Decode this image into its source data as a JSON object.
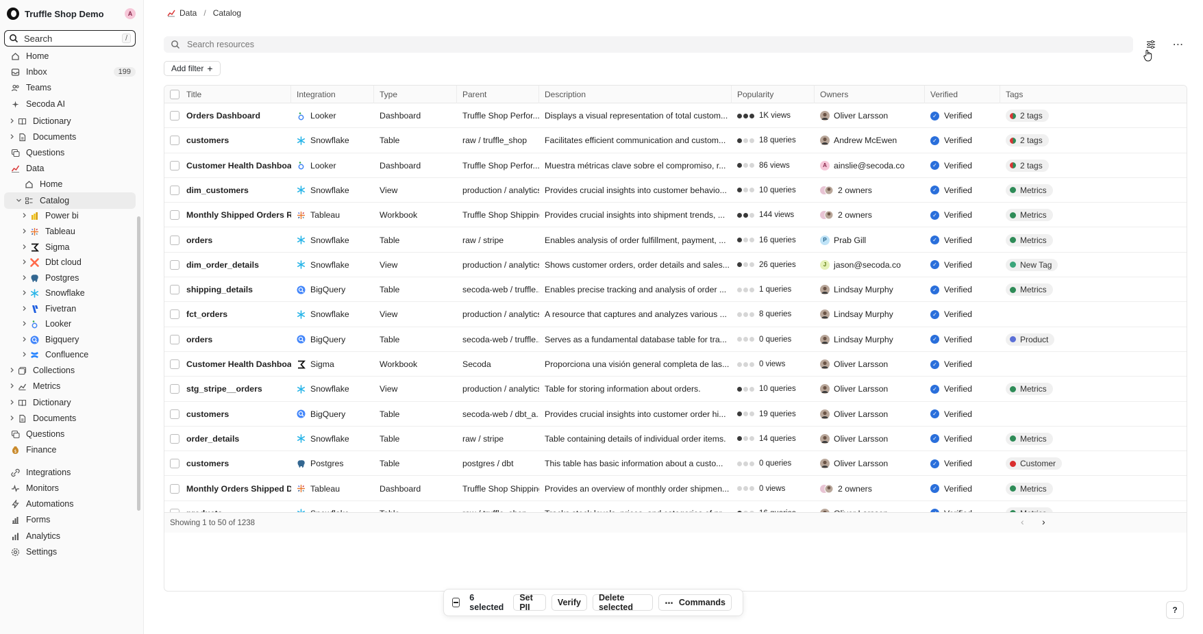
{
  "workspace": {
    "name": "Truffle Shop Demo",
    "avatar": "A"
  },
  "sidebar": {
    "search_label": "Search",
    "search_shortcut": "/",
    "items": [
      {
        "label": "Home",
        "icon": "home-icon",
        "depth": 0
      },
      {
        "label": "Inbox",
        "icon": "inbox-icon",
        "depth": 0,
        "count": "199"
      },
      {
        "label": "Teams",
        "icon": "teams-icon",
        "depth": 0
      },
      {
        "label": "Secoda AI",
        "icon": "sparkle-icon",
        "depth": 0
      },
      {
        "label": "Dictionary",
        "icon": "book-icon",
        "depth": 0,
        "chevron": true
      },
      {
        "label": "Documents",
        "icon": "document-icon",
        "depth": 0,
        "chevron": true
      },
      {
        "label": "Questions",
        "icon": "question-icon",
        "depth": 0
      },
      {
        "label": "Data",
        "icon": "chart-icon",
        "depth": 0,
        "section": true
      },
      {
        "label": "Home",
        "icon": "home-icon",
        "depth": 1
      },
      {
        "label": "Catalog",
        "icon": "catalog-icon",
        "depth": 1,
        "chevron": true,
        "expanded": true,
        "active": true
      },
      {
        "label": "Power bi",
        "icon": "powerbi-icon",
        "depth": 2,
        "chevron": true
      },
      {
        "label": "Tableau",
        "icon": "tableau-icon",
        "depth": 2,
        "chevron": true
      },
      {
        "label": "Sigma",
        "icon": "sigma-icon",
        "depth": 2,
        "chevron": true
      },
      {
        "label": "Dbt cloud",
        "icon": "dbt-icon",
        "depth": 2,
        "chevron": true
      },
      {
        "label": "Postgres",
        "icon": "postgres-icon",
        "depth": 2,
        "chevron": true
      },
      {
        "label": "Snowflake",
        "icon": "snowflake-icon",
        "depth": 2,
        "chevron": true
      },
      {
        "label": "Fivetran",
        "icon": "fivetran-icon",
        "depth": 2,
        "chevron": true
      },
      {
        "label": "Looker",
        "icon": "looker-icon",
        "depth": 2,
        "chevron": true
      },
      {
        "label": "Bigquery",
        "icon": "bigquery-icon",
        "depth": 2,
        "chevron": true
      },
      {
        "label": "Confluence",
        "icon": "confluence-icon",
        "depth": 2,
        "chevron": true
      },
      {
        "label": "Collections",
        "icon": "collections-icon",
        "depth": 0,
        "chevron": true
      },
      {
        "label": "Metrics",
        "icon": "metrics-icon",
        "depth": 0,
        "chevron": true
      },
      {
        "label": "Dictionary",
        "icon": "book-icon",
        "depth": 0,
        "chevron": true
      },
      {
        "label": "Documents",
        "icon": "document-icon",
        "depth": 0,
        "chevron": true
      },
      {
        "label": "Questions",
        "icon": "question-icon",
        "depth": 0
      },
      {
        "label": "Finance",
        "icon": "finance-icon",
        "depth": 0,
        "section": true
      },
      {
        "label": "Integrations",
        "icon": "integrations-icon",
        "depth": 0
      },
      {
        "label": "Monitors",
        "icon": "monitor-icon",
        "depth": 0
      },
      {
        "label": "Automations",
        "icon": "automation-icon",
        "depth": 0
      },
      {
        "label": "Forms",
        "icon": "forms-icon",
        "depth": 0
      },
      {
        "label": "Analytics",
        "icon": "analytics-icon",
        "depth": 0
      },
      {
        "label": "Settings",
        "icon": "settings-icon",
        "depth": 0
      }
    ]
  },
  "breadcrumb": {
    "section": "Data",
    "separator": "/",
    "page": "Catalog"
  },
  "main": {
    "search_placeholder": "Search resources",
    "add_filter": "Add filter"
  },
  "table": {
    "columns": [
      "Title",
      "Integration",
      "Type",
      "Parent",
      "Description",
      "Popularity",
      "Owners",
      "Verified",
      "Tags"
    ],
    "rows": [
      {
        "title": "Orders Dashboard",
        "integration": "Looker",
        "int_icon": "looker-icon",
        "type": "Dashboard",
        "parent": "Truffle Shop Perfor...",
        "description": "Displays a visual representation of total custom...",
        "pop_level": 3,
        "popularity": "1K views",
        "owner": "Oliver Larsson",
        "owner_av": "photo",
        "verified": "Verified",
        "tag": "2 tags",
        "tag_color": "multi"
      },
      {
        "title": "customers",
        "integration": "Snowflake",
        "int_icon": "snowflake-icon",
        "type": "Table",
        "parent": "raw / truffle_shop",
        "description": "Facilitates efficient communication and custom...",
        "pop_level": 1,
        "popularity": "18 queries",
        "owner": "Andrew McEwen",
        "owner_av": "photo",
        "verified": "Verified",
        "tag": "2 tags",
        "tag_color": "multi"
      },
      {
        "title": "Customer Health Dashboard",
        "integration": "Looker",
        "int_icon": "looker-icon",
        "type": "Dashboard",
        "parent": "Truffle Shop Perfor...",
        "description": "Muestra métricas clave sobre el compromiso, r...",
        "pop_level": 1,
        "popularity": "86 views",
        "owner": "ainslie@secoda.co",
        "owner_av": "A",
        "verified": "Verified",
        "tag": "2 tags",
        "tag_color": "multi"
      },
      {
        "title": "dim_customers",
        "integration": "Snowflake",
        "int_icon": "snowflake-icon",
        "type": "View",
        "parent": "production / analytics",
        "description": "Provides crucial insights into customer behavio...",
        "pop_level": 1,
        "popularity": "10 queries",
        "owner": "2 owners",
        "owner_av": "multi",
        "verified": "Verified",
        "tag": "Metrics",
        "tag_color": "#2e8b57"
      },
      {
        "title": "Monthly Shipped Orders R...",
        "integration": "Tableau",
        "int_icon": "tableau-icon",
        "type": "Workbook",
        "parent": "Truffle Shop Shipping",
        "description": "Provides crucial insights into shipment trends, ...",
        "pop_level": 2,
        "popularity": "144 views",
        "owner": "2 owners",
        "owner_av": "multi",
        "verified": "Verified",
        "tag": "Metrics",
        "tag_color": "#2e8b57"
      },
      {
        "title": "orders",
        "integration": "Snowflake",
        "int_icon": "snowflake-icon",
        "type": "Table",
        "parent": "raw / stripe",
        "description": "Enables analysis of order fulfillment, payment, ...",
        "pop_level": 1,
        "popularity": "16 queries",
        "owner": "Prab Gill",
        "owner_av": "P",
        "verified": "Verified",
        "tag": "Metrics",
        "tag_color": "#2e8b57"
      },
      {
        "title": "dim_order_details",
        "integration": "Snowflake",
        "int_icon": "snowflake-icon",
        "type": "View",
        "parent": "production / analytics",
        "description": "Shows customer orders, order details and sales...",
        "pop_level": 1,
        "popularity": "26 queries",
        "owner": "jason@secoda.co",
        "owner_av": "J",
        "verified": "Verified",
        "tag": "New Tag",
        "tag_color": "#3aa57a"
      },
      {
        "title": "shipping_details",
        "integration": "BigQuery",
        "int_icon": "bigquery-icon",
        "type": "Table",
        "parent": "secoda-web / truffle...",
        "description": "Enables precise tracking and analysis of order ...",
        "pop_level": 0,
        "popularity": "1 queries",
        "owner": "Lindsay Murphy",
        "owner_av": "photo",
        "verified": "Verified",
        "tag": "Metrics",
        "tag_color": "#2e8b57"
      },
      {
        "title": "fct_orders",
        "integration": "Snowflake",
        "int_icon": "snowflake-icon",
        "type": "View",
        "parent": "production / analytics",
        "description": "A resource that captures and analyzes various ...",
        "pop_level": 0,
        "popularity": "8 queries",
        "owner": "Lindsay Murphy",
        "owner_av": "photo",
        "verified": "Verified",
        "tag": "",
        "tag_color": ""
      },
      {
        "title": "orders",
        "integration": "BigQuery",
        "int_icon": "bigquery-icon",
        "type": "Table",
        "parent": "secoda-web / truffle...",
        "description": "Serves as a fundamental database table for tra...",
        "pop_level": 0,
        "popularity": "0 queries",
        "owner": "Lindsay Murphy",
        "owner_av": "photo",
        "verified": "Verified",
        "tag": "Product",
        "tag_color": "#5b6fd6"
      },
      {
        "title": "Customer Health Dashboard",
        "integration": "Sigma",
        "int_icon": "sigma-icon",
        "type": "Workbook",
        "parent": "Secoda",
        "description": "Proporciona una visión general completa de las...",
        "pop_level": 0,
        "popularity": "0 views",
        "owner": "Oliver Larsson",
        "owner_av": "photo",
        "verified": "Verified",
        "tag": "",
        "tag_color": ""
      },
      {
        "title": "stg_stripe__orders",
        "integration": "Snowflake",
        "int_icon": "snowflake-icon",
        "type": "View",
        "parent": "production / analytics",
        "description": "Table for storing information about orders.",
        "pop_level": 1,
        "popularity": "10 queries",
        "owner": "Oliver Larsson",
        "owner_av": "photo",
        "verified": "Verified",
        "tag": "Metrics",
        "tag_color": "#2e8b57"
      },
      {
        "title": "customers",
        "integration": "BigQuery",
        "int_icon": "bigquery-icon",
        "type": "Table",
        "parent": "secoda-web / dbt_a...",
        "description": "Provides crucial insights into customer order hi...",
        "pop_level": 1,
        "popularity": "19 queries",
        "owner": "Oliver Larsson",
        "owner_av": "photo",
        "verified": "Verified",
        "tag": "",
        "tag_color": ""
      },
      {
        "title": "order_details",
        "integration": "Snowflake",
        "int_icon": "snowflake-icon",
        "type": "Table",
        "parent": "raw / stripe",
        "description": "Table containing details of individual order items.",
        "pop_level": 1,
        "popularity": "14 queries",
        "owner": "Oliver Larsson",
        "owner_av": "photo",
        "verified": "Verified",
        "tag": "Metrics",
        "tag_color": "#2e8b57"
      },
      {
        "title": "customers",
        "integration": "Postgres",
        "int_icon": "postgres-icon",
        "type": "Table",
        "parent": "postgres / dbt",
        "description": "This table has basic information about a custo...",
        "pop_level": 0,
        "popularity": "0 queries",
        "owner": "Oliver Larsson",
        "owner_av": "photo",
        "verified": "Verified",
        "tag": "Customer",
        "tag_color": "#d92d2d"
      },
      {
        "title": "Monthly Orders Shipped D...",
        "integration": "Tableau",
        "int_icon": "tableau-icon",
        "type": "Dashboard",
        "parent": "Truffle Shop Shipping",
        "description": "Provides an overview of monthly order shipmen...",
        "pop_level": 0,
        "popularity": "0 views",
        "owner": "2 owners",
        "owner_av": "multi",
        "verified": "Verified",
        "tag": "Metrics",
        "tag_color": "#2e8b57"
      },
      {
        "title": "products",
        "integration": "Snowflake",
        "int_icon": "snowflake-icon",
        "type": "Table",
        "parent": "raw / truffle_shop",
        "description": "Tracks stock levels, prices, and categories of pr...",
        "pop_level": 1,
        "popularity": "16 queries",
        "owner": "Oliver Larsson",
        "owner_av": "photo",
        "verified": "Verified",
        "tag": "Metrics",
        "tag_color": "#2e8b57"
      }
    ],
    "footer": "Showing 1 to 50 of 1238"
  },
  "action_bar": {
    "selected": "6 selected",
    "set_pii": "Set PII",
    "verify": "Verify",
    "delete": "Delete selected",
    "commands": "Commands",
    "commands_icon": "⋯"
  },
  "help_label": "?"
}
